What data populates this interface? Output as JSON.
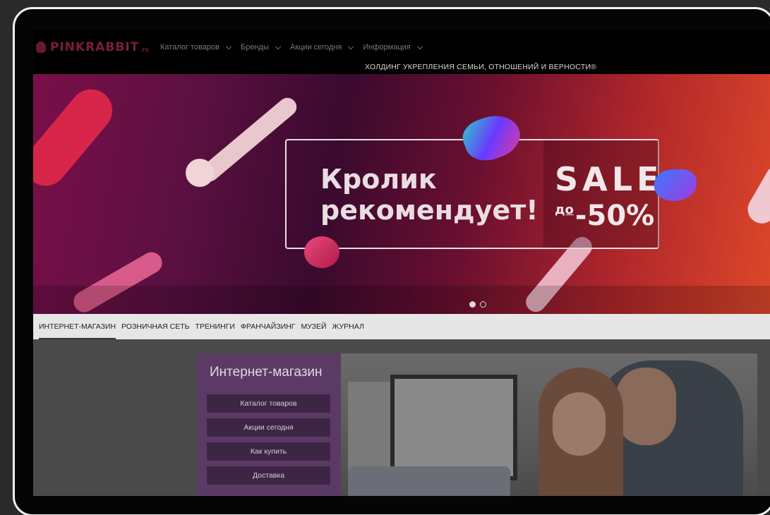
{
  "header": {
    "logo_text": "PINKRABBIT",
    "logo_suffix": ".ru",
    "nav": [
      "Каталог товаров",
      "Бренды",
      "Акции сегодня",
      "Информация"
    ],
    "tagline": "ХОЛДИНГ УКРЕПЛЕНИЯ СЕМЬИ, ОТНОШЕНИЙ И ВЕРНОСТИ®"
  },
  "banner": {
    "title_line1": "Кролик",
    "title_line2": "рекомендует!",
    "sale": "SALE",
    "sale_prefix": "до",
    "sale_percent": "-50%",
    "slides_total": 2,
    "slide_active": 1
  },
  "tabs": [
    "ИНТЕРНЕТ-МАГАЗИН",
    "РОЗНИЧНАЯ СЕТЬ",
    "ТРЕНИНГИ",
    "ФРАНЧАЙЗИНГ",
    "МУЗЕЙ",
    "ЖУРНАЛ"
  ],
  "shop": {
    "title": "Интернет-магазин",
    "buttons": [
      "Каталог товаров",
      "Акции сегодня",
      "Как купить",
      "Доставка"
    ]
  },
  "colors": {
    "accent": "#5b3b66",
    "logo": "#7a1f35"
  }
}
